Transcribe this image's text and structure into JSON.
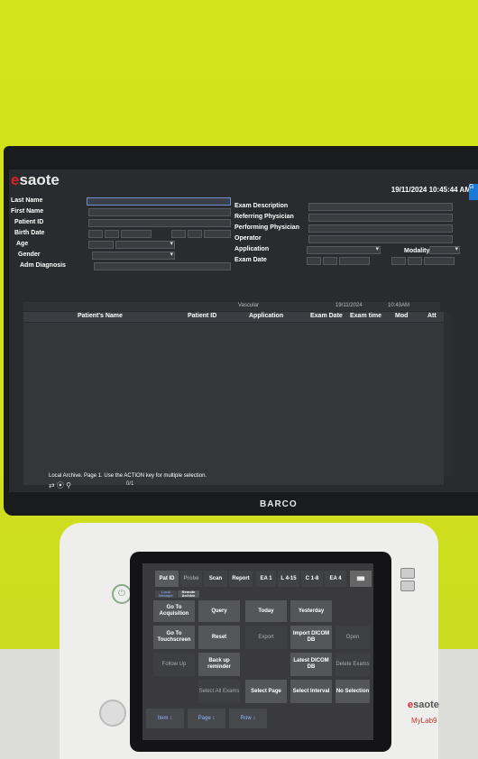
{
  "monitor": {
    "brand": "esaote",
    "brand_initial": "e",
    "brand_rest": "saote",
    "datetime": "19/11/2024 10:45:44 AM",
    "go_label": "G",
    "labels_left": [
      "Last Name",
      "First Name",
      "Patient ID",
      "Birth Date",
      "Age",
      "Gender",
      "Adm Diagnosis"
    ],
    "labels_mid": [
      "Exam Description",
      "Referring Physician",
      "Performing Physician",
      "Operator",
      "Application",
      "Exam Date"
    ],
    "modality_label": "Modality",
    "info_bar": {
      "app": "Vascular",
      "date": "19/11/2024",
      "time": "10:43AM"
    },
    "table_headers": [
      "Patient's Name",
      "Patient ID",
      "Application",
      "Exam Date",
      "Exam time",
      "Mod",
      "Att"
    ],
    "status": "Local Archive. Page 1. Use the ACTION key for multiple selection.",
    "page_indicator": "0/1",
    "barco": "BARCO"
  },
  "touch": {
    "tabs": [
      "Pat ID",
      "Probe",
      "Scan",
      "Report"
    ],
    "probes": [
      "EA 1",
      "L 4-15",
      "C 1-8",
      "EA 4"
    ],
    "subtabs": [
      "Local Manager",
      "Remote Archive"
    ],
    "buttons": [
      [
        "Go To Acquisition",
        "Query",
        "Today",
        "Yesterday"
      ],
      [
        "Go To Touchscreen",
        "Reset",
        "Export",
        "Import DICOM DB",
        "Open"
      ],
      [
        "Follow Up",
        "Back up reminder",
        "Latest DICOM DB",
        "Delete Exams"
      ],
      [
        "Select All Exams",
        "Select Page",
        "Select Interval",
        "No Selection"
      ]
    ],
    "bottom": [
      "Item ↕",
      "Page ↕",
      "Row ↕"
    ]
  },
  "console": {
    "logo_initial": "e",
    "logo_rest": "saote",
    "model": "MyLab9"
  }
}
